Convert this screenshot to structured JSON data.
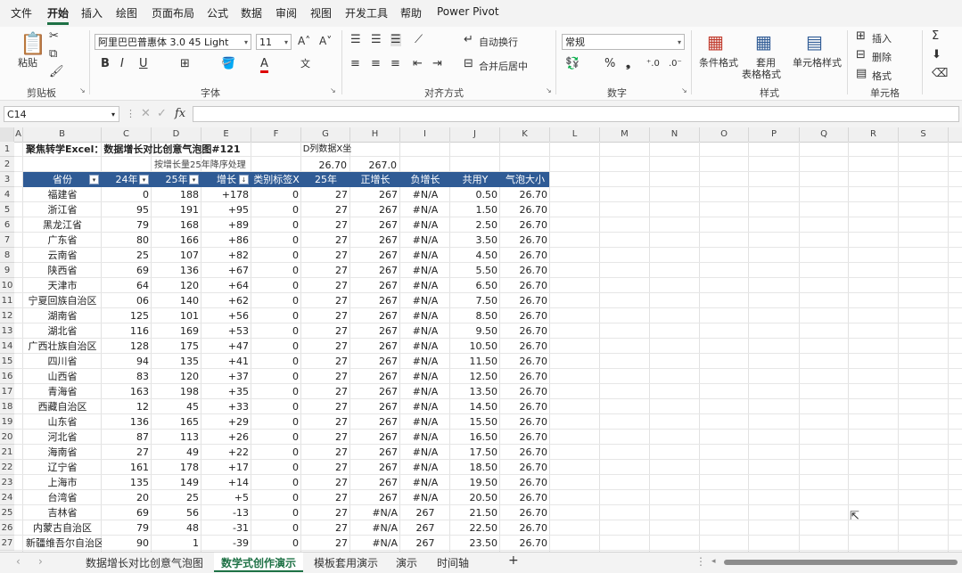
{
  "menu": {
    "items": [
      "文件",
      "开始",
      "插入",
      "绘图",
      "页面布局",
      "公式",
      "数据",
      "审阅",
      "视图",
      "开发工具",
      "帮助",
      "Power Pivot"
    ],
    "active": "开始"
  },
  "ribbon": {
    "clipboard": {
      "paste": "粘贴",
      "label": "剪贴板"
    },
    "font": {
      "name": "阿里巴巴普惠体 3.0 45 Light",
      "size": "11",
      "bold": "B",
      "italic": "I",
      "underline": "U",
      "label": "字体"
    },
    "align": {
      "wrap": "自动换行",
      "merge": "合并后居中",
      "label": "对齐方式"
    },
    "number": {
      "format": "常规",
      "percent": "%",
      "label": "数字"
    },
    "styles": {
      "cond": "条件格式",
      "table_line1": "套用",
      "table_line2": "表格格式",
      "cell": "单元格样式",
      "label": "样式"
    },
    "cells": {
      "insert": "插入",
      "delete": "删除",
      "format": "格式",
      "label": "单元格"
    }
  },
  "formula": {
    "namebox": "C14",
    "fx": "fx",
    "value": ""
  },
  "columns": [
    "A",
    "B",
    "C",
    "D",
    "E",
    "F",
    "G",
    "H",
    "I",
    "J",
    "K",
    "L",
    "M",
    "N",
    "O",
    "P",
    "Q",
    "R",
    "S"
  ],
  "sheet": {
    "title": "聚焦转学Excel：数据增长对比创意气泡图#121",
    "sort_note": "按增长量25年降序处理",
    "g1": "D列数据X坐",
    "g2": "26.70",
    "h2": "267.0",
    "headers": [
      "省份",
      "24年",
      "25年",
      "增长",
      "类别标签X",
      "25年",
      "正增长",
      "负增长",
      "共用Y",
      "气泡大小"
    ],
    "rows": [
      [
        "福建省",
        "0",
        "188",
        "+178",
        "0",
        "27",
        "267",
        "#N/A",
        "0.50",
        "26.70"
      ],
      [
        "浙江省",
        "95",
        "191",
        "+95",
        "0",
        "27",
        "267",
        "#N/A",
        "1.50",
        "26.70"
      ],
      [
        "黑龙江省",
        "79",
        "168",
        "+89",
        "0",
        "27",
        "267",
        "#N/A",
        "2.50",
        "26.70"
      ],
      [
        "广东省",
        "80",
        "166",
        "+86",
        "0",
        "27",
        "267",
        "#N/A",
        "3.50",
        "26.70"
      ],
      [
        "云南省",
        "25",
        "107",
        "+82",
        "0",
        "27",
        "267",
        "#N/A",
        "4.50",
        "26.70"
      ],
      [
        "陕西省",
        "69",
        "136",
        "+67",
        "0",
        "27",
        "267",
        "#N/A",
        "5.50",
        "26.70"
      ],
      [
        "天津市",
        "64",
        "120",
        "+64",
        "0",
        "27",
        "267",
        "#N/A",
        "6.50",
        "26.70"
      ],
      [
        "宁夏回族自治区",
        "06",
        "140",
        "+62",
        "0",
        "27",
        "267",
        "#N/A",
        "7.50",
        "26.70"
      ],
      [
        "湖南省",
        "125",
        "101",
        "+56",
        "0",
        "27",
        "267",
        "#N/A",
        "8.50",
        "26.70"
      ],
      [
        "湖北省",
        "116",
        "169",
        "+53",
        "0",
        "27",
        "267",
        "#N/A",
        "9.50",
        "26.70"
      ],
      [
        "广西壮族自治区",
        "128",
        "175",
        "+47",
        "0",
        "27",
        "267",
        "#N/A",
        "10.50",
        "26.70"
      ],
      [
        "四川省",
        "94",
        "135",
        "+41",
        "0",
        "27",
        "267",
        "#N/A",
        "11.50",
        "26.70"
      ],
      [
        "山西省",
        "83",
        "120",
        "+37",
        "0",
        "27",
        "267",
        "#N/A",
        "12.50",
        "26.70"
      ],
      [
        "青海省",
        "163",
        "198",
        "+35",
        "0",
        "27",
        "267",
        "#N/A",
        "13.50",
        "26.70"
      ],
      [
        "西藏自治区",
        "12",
        "45",
        "+33",
        "0",
        "27",
        "267",
        "#N/A",
        "14.50",
        "26.70"
      ],
      [
        "山东省",
        "136",
        "165",
        "+29",
        "0",
        "27",
        "267",
        "#N/A",
        "15.50",
        "26.70"
      ],
      [
        "河北省",
        "87",
        "113",
        "+26",
        "0",
        "27",
        "267",
        "#N/A",
        "16.50",
        "26.70"
      ],
      [
        "海南省",
        "27",
        "49",
        "+22",
        "0",
        "27",
        "267",
        "#N/A",
        "17.50",
        "26.70"
      ],
      [
        "辽宁省",
        "161",
        "178",
        "+17",
        "0",
        "27",
        "267",
        "#N/A",
        "18.50",
        "26.70"
      ],
      [
        "上海市",
        "135",
        "149",
        "+14",
        "0",
        "27",
        "267",
        "#N/A",
        "19.50",
        "26.70"
      ],
      [
        "台湾省",
        "20",
        "25",
        "+5",
        "0",
        "27",
        "267",
        "#N/A",
        "20.50",
        "26.70"
      ],
      [
        "吉林省",
        "69",
        "56",
        "-13",
        "0",
        "27",
        "#N/A",
        "267",
        "21.50",
        "26.70"
      ],
      [
        "内蒙古自治区",
        "79",
        "48",
        "-31",
        "0",
        "27",
        "#N/A",
        "267",
        "22.50",
        "26.70"
      ],
      [
        "新疆维吾尔自治区",
        "90",
        "1",
        "-39",
        "0",
        "27",
        "#N/A",
        "267",
        "23.50",
        "26.70"
      ]
    ]
  },
  "tabs": [
    "数据增长对比创意气泡图",
    "数学式创作演示",
    "模板套用演示",
    "演示",
    "时间轴"
  ],
  "active_tab": "数学式创作演示"
}
